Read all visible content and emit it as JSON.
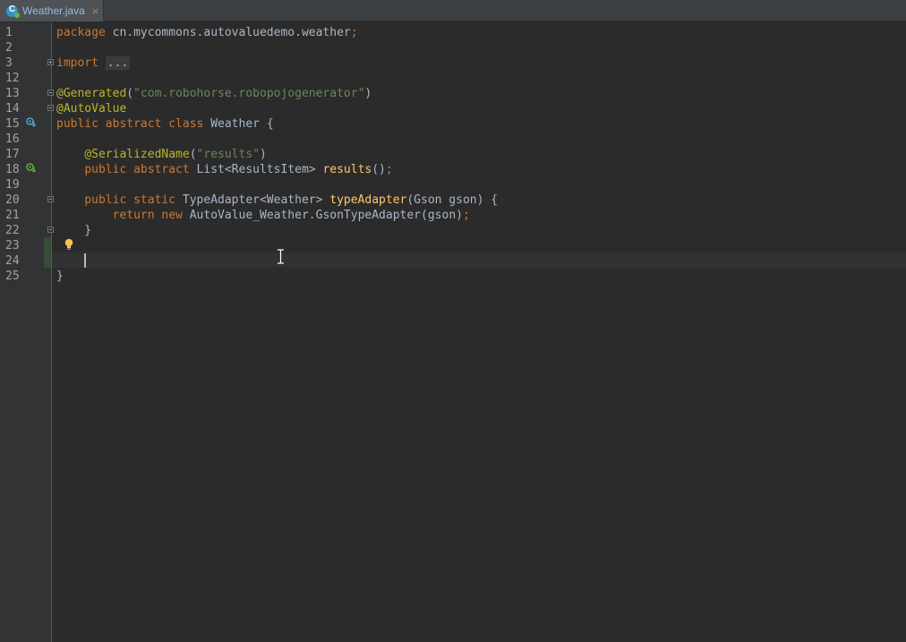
{
  "tab": {
    "label": "Weather.java",
    "close": "×",
    "icon": "java-class-icon"
  },
  "lines": [
    {
      "num": "1",
      "tokens": [
        {
          "t": "kw",
          "v": "package"
        },
        {
          "t": "",
          "v": " cn.mycommons.autovaluedemo.weather"
        },
        {
          "t": "kw",
          "v": ";"
        }
      ]
    },
    {
      "num": "2",
      "tokens": []
    },
    {
      "num": "3",
      "tokens": [
        {
          "t": "kw",
          "v": "import"
        },
        {
          "t": "",
          "v": " "
        },
        {
          "t": "fold-text",
          "v": "..."
        }
      ]
    },
    {
      "num": "12",
      "tokens": []
    },
    {
      "num": "13",
      "tokens": [
        {
          "t": "ann",
          "v": "@Generated"
        },
        {
          "t": "",
          "v": "("
        },
        {
          "t": "str",
          "v": "\"com.robohorse.robopojogenerator\""
        },
        {
          "t": "",
          "v": ")"
        }
      ]
    },
    {
      "num": "14",
      "tokens": [
        {
          "t": "ann",
          "v": "@AutoValue"
        }
      ]
    },
    {
      "num": "15",
      "tokens": [
        {
          "t": "kw",
          "v": "public abstract class"
        },
        {
          "t": "",
          "v": " Weather {"
        }
      ]
    },
    {
      "num": "16",
      "tokens": []
    },
    {
      "num": "17",
      "tokens": [
        {
          "t": "",
          "v": "    "
        },
        {
          "t": "ann",
          "v": "@SerializedName"
        },
        {
          "t": "",
          "v": "("
        },
        {
          "t": "str",
          "v": "\"results\""
        },
        {
          "t": "",
          "v": ")"
        }
      ]
    },
    {
      "num": "18",
      "tokens": [
        {
          "t": "",
          "v": "    "
        },
        {
          "t": "kw",
          "v": "public abstract"
        },
        {
          "t": "",
          "v": " List<ResultsItem> "
        },
        {
          "t": "fn",
          "v": "results"
        },
        {
          "t": "",
          "v": "()"
        },
        {
          "t": "kw",
          "v": ";"
        }
      ]
    },
    {
      "num": "19",
      "tokens": []
    },
    {
      "num": "20",
      "tokens": [
        {
          "t": "",
          "v": "    "
        },
        {
          "t": "kw",
          "v": "public static"
        },
        {
          "t": "",
          "v": " TypeAdapter<Weather> "
        },
        {
          "t": "fn",
          "v": "typeAdapter"
        },
        {
          "t": "",
          "v": "(Gson gson) {"
        }
      ]
    },
    {
      "num": "21",
      "tokens": [
        {
          "t": "",
          "v": "        "
        },
        {
          "t": "kw",
          "v": "return new"
        },
        {
          "t": "",
          "v": " AutoValue_Weather.GsonTypeAdapter(gson)"
        },
        {
          "t": "kw",
          "v": ";"
        }
      ]
    },
    {
      "num": "22",
      "tokens": [
        {
          "t": "",
          "v": "    }"
        }
      ]
    },
    {
      "num": "23",
      "tokens": []
    },
    {
      "num": "24",
      "tokens": []
    },
    {
      "num": "25",
      "tokens": [
        {
          "t": "",
          "v": "}"
        }
      ]
    }
  ],
  "colors": {
    "background": "#2b2b2b",
    "gutter": "#313335",
    "keyword": "#cc7832",
    "annotation": "#bbb529",
    "string": "#6a8759",
    "method": "#ffc66d",
    "text": "#a9b7c6"
  }
}
